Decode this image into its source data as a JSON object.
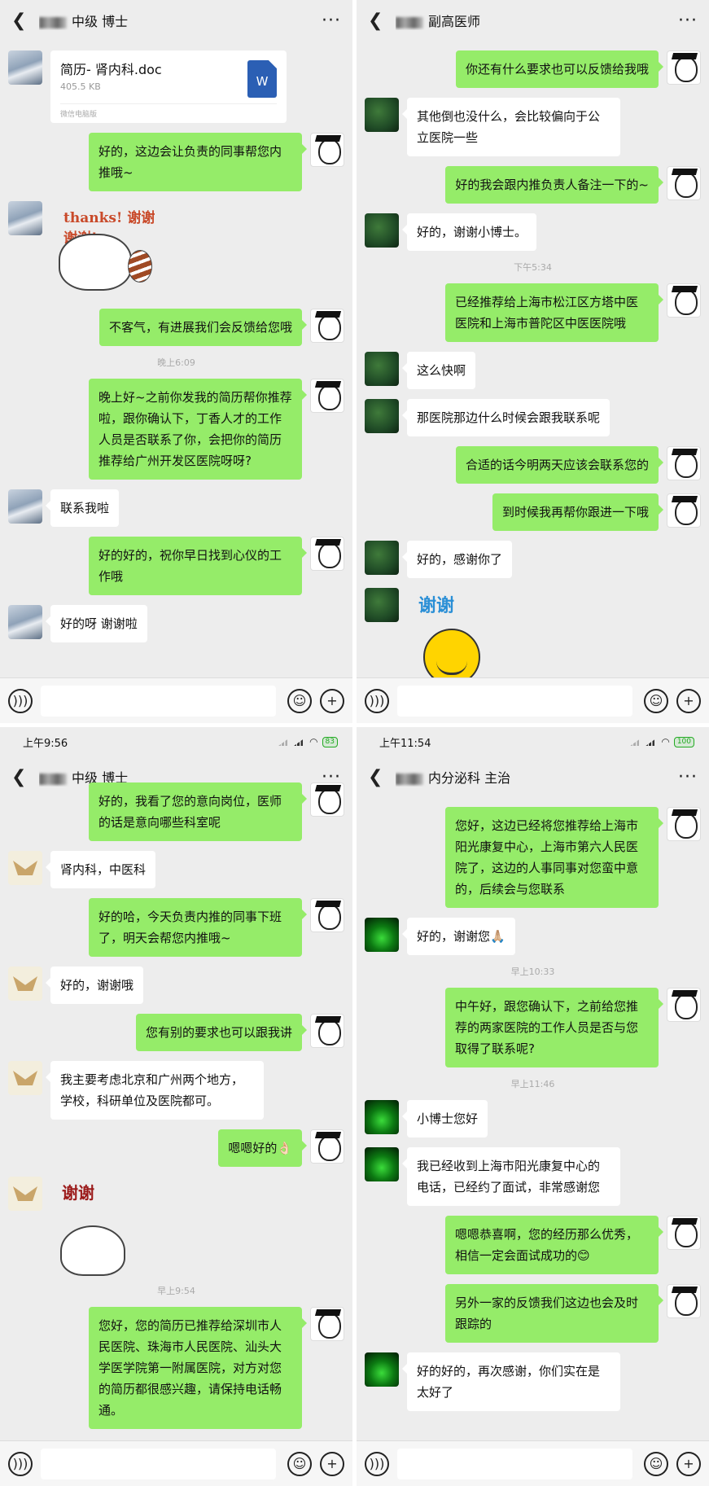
{
  "common": {
    "back_icon": "chevron-left-icon",
    "more_label": "···",
    "voice_icon": "voice-icon",
    "emoji_icon": "emoji-icon",
    "plus_icon": "plus-icon"
  },
  "panels": [
    {
      "title": "中级 博士",
      "messages": [
        {
          "type": "file",
          "name": "简历-  肾内科.doc",
          "size": "405.5 KB",
          "source": "微信电脑版",
          "icon": "W"
        },
        {
          "type": "text",
          "side": "right",
          "text": "好的，这边会让负责的同事帮您内推哦~"
        },
        {
          "type": "sticker",
          "side": "left",
          "label": "thanks! 谢谢 谢谢!",
          "sticker": "raccoon-thanks-sticker"
        },
        {
          "type": "text",
          "side": "right",
          "text": "不客气，有进展我们会反馈给您哦"
        },
        {
          "type": "time",
          "text": "晚上6:09"
        },
        {
          "type": "text",
          "side": "right",
          "text": "晚上好~之前你发我的简历帮你推荐啦，跟你确认下，丁香人才的工作人员是否联系了你，会把你的简历推荐给广州开发区医院呀呀?"
        },
        {
          "type": "text",
          "side": "left",
          "text": "联系我啦"
        },
        {
          "type": "text",
          "side": "right",
          "text": "好的好的，祝你早日找到心仪的工作哦"
        },
        {
          "type": "text",
          "side": "left",
          "text": "好的呀 谢谢啦"
        }
      ]
    },
    {
      "title": "副高医师",
      "messages": [
        {
          "type": "text",
          "side": "right",
          "text": "你还有什么要求也可以反馈给我哦"
        },
        {
          "type": "text",
          "side": "left",
          "text": "其他倒也没什么，会比较偏向于公立医院一些"
        },
        {
          "type": "text",
          "side": "right",
          "text": "好的我会跟内推负责人备注一下的~"
        },
        {
          "type": "text",
          "side": "left",
          "text": "好的，谢谢小博士。"
        },
        {
          "type": "time",
          "text": "下午5:34"
        },
        {
          "type": "text",
          "side": "right",
          "text": "已经推荐给上海市松江区方塔中医医院和上海市普陀区中医医院哦"
        },
        {
          "type": "text",
          "side": "left",
          "text": "这么快啊"
        },
        {
          "type": "text",
          "side": "left",
          "text": "那医院那边什么时候会跟我联系呢"
        },
        {
          "type": "text",
          "side": "right",
          "text": "合适的话今明两天应该会联系您的"
        },
        {
          "type": "text",
          "side": "right",
          "text": "到时候我再帮你跟进一下哦"
        },
        {
          "type": "text",
          "side": "left",
          "text": "好的，感谢你了"
        },
        {
          "type": "sticker",
          "side": "left",
          "label": "谢谢",
          "sticker": "smiley-thanks-sticker"
        }
      ]
    },
    {
      "status": {
        "time": "上午9:56",
        "battery": "83"
      },
      "title": "中级 博士",
      "messages": [
        {
          "type": "text",
          "side": "right",
          "text": "好的，我看了您的意向岗位，医师的话是意向哪些科室呢"
        },
        {
          "type": "text",
          "side": "left",
          "text": "肾内科，中医科"
        },
        {
          "type": "text",
          "side": "right",
          "text": "好的哈，今天负责内推的同事下班了，明天会帮您内推哦~"
        },
        {
          "type": "text",
          "side": "left",
          "text": "好的，谢谢哦"
        },
        {
          "type": "text",
          "side": "right",
          "text": "您有别的要求也可以跟我讲"
        },
        {
          "type": "text",
          "side": "left",
          "text": "我主要考虑北京和广州两个地方，学校，科研单位及医院都可。"
        },
        {
          "type": "text",
          "side": "right",
          "text": "嗯嗯好的👌🏻"
        },
        {
          "type": "sticker",
          "side": "left",
          "label": "谢谢",
          "sticker": "bowing-thanks-sticker"
        },
        {
          "type": "time",
          "text": "早上9:54"
        },
        {
          "type": "text",
          "side": "right",
          "text": "您好，您的简历已推荐给深圳市人民医院、珠海市人民医院、汕头大学医学院第一附属医院，对方对您的简历都很感兴趣，请保持电话畅通。"
        }
      ]
    },
    {
      "status": {
        "time": "上午11:54",
        "battery": "100"
      },
      "title": "内分泌科 主治",
      "messages": [
        {
          "type": "text",
          "side": "right",
          "text": "您好，这边已经将您推荐给上海市阳光康复中心，上海市第六人民医院了，这边的人事同事对您蛮中意的，后续会与您联系"
        },
        {
          "type": "text",
          "side": "left",
          "text": "好的，谢谢您🙏🏼"
        },
        {
          "type": "time",
          "text": "早上10:33"
        },
        {
          "type": "text",
          "side": "right",
          "text": "中午好，跟您确认下，之前给您推荐的两家医院的工作人员是否与您取得了联系呢?"
        },
        {
          "type": "time",
          "text": "早上11:46"
        },
        {
          "type": "text",
          "side": "left",
          "text": "小博士您好"
        },
        {
          "type": "text",
          "side": "left",
          "text": "我已经收到上海市阳光康复中心的电话，已经约了面试，非常感谢您"
        },
        {
          "type": "text",
          "side": "right",
          "text": "嗯嗯恭喜啊，您的经历那么优秀，相信一定会面试成功的😊"
        },
        {
          "type": "text",
          "side": "right",
          "text": "另外一家的反馈我们这边也会及时跟踪的"
        },
        {
          "type": "text",
          "side": "left",
          "text": "好的好的，再次感谢，你们实在是太好了"
        }
      ]
    }
  ],
  "colors": {
    "sent_bubble": "#95ec69",
    "received_bubble": "#ffffff",
    "background": "#ededed"
  }
}
